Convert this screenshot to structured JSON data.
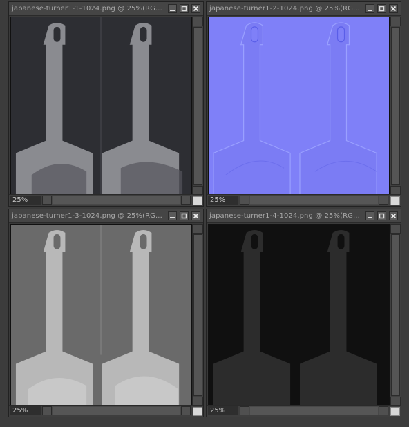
{
  "windows": [
    {
      "id": "w1",
      "title": "japanese-turner1-1-1024.png @ 25%(RG...",
      "zoom": "25%",
      "map": "diffuse"
    },
    {
      "id": "w2",
      "title": "japanese-turner1-2-1024.png @ 25%(RG...",
      "zoom": "25%",
      "map": "normal"
    },
    {
      "id": "w3",
      "title": "japanese-turner1-3-1024.png @ 25%(RG...",
      "zoom": "25%",
      "map": "specular"
    },
    {
      "id": "w4",
      "title": "japanese-turner1-4-1024.png @ 25%(RG...",
      "zoom": "25%",
      "map": "dark"
    }
  ],
  "icons": {
    "minimize": "minimize-icon",
    "maximize": "maximize-icon",
    "close": "close-icon",
    "scroll_up": "arrow-up-icon",
    "scroll_down": "arrow-down-icon",
    "scroll_left": "arrow-left-icon",
    "scroll_right": "arrow-right-icon",
    "resize": "resize-grip-icon"
  },
  "colors": {
    "diffuse_bg": "#2d2e33",
    "diffuse_shape": "#8a8b90",
    "normal_bg": "#7f80f8",
    "normal_shape": "#7b7cf4",
    "specular_bg": "#6a6a6a",
    "specular_shape": "#b8b8b8",
    "dark_bg": "#101010",
    "dark_shape": "#2c2c2c"
  }
}
